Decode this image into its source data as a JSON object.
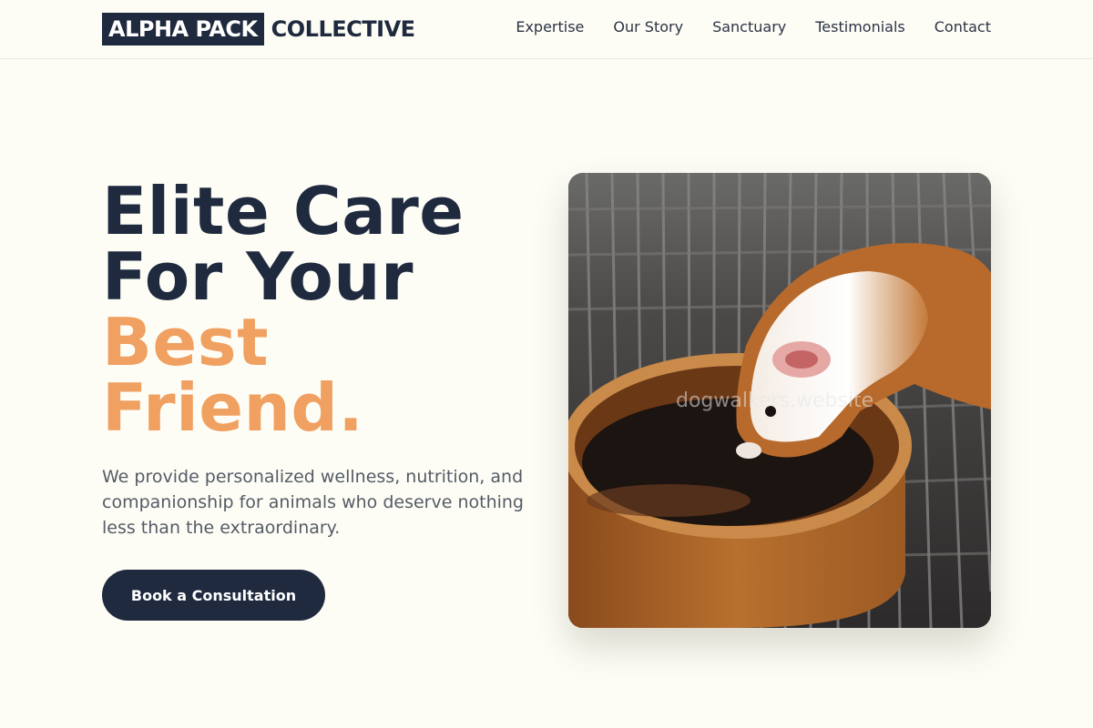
{
  "brand": {
    "highlight": "ALPHA PACK",
    "rest": "COLLECTIVE"
  },
  "nav": {
    "items": [
      {
        "label": "Expertise"
      },
      {
        "label": "Our Story"
      },
      {
        "label": "Sanctuary"
      },
      {
        "label": "Testimonials"
      },
      {
        "label": "Contact"
      }
    ]
  },
  "hero": {
    "title_line1": "Elite Care",
    "title_line2": "For Your",
    "title_line3": "Best",
    "title_line4": "Friend.",
    "description": "We provide personalized wellness, nutrition, and companionship for animals who deserve nothing less than the extraordinary.",
    "cta_label": "Book a Consultation"
  },
  "photo": {
    "watermark": "dogwalkers.website"
  },
  "colors": {
    "navy": "#1f2a3f",
    "accent": "#f0a060",
    "background": "#fdfdf6"
  }
}
